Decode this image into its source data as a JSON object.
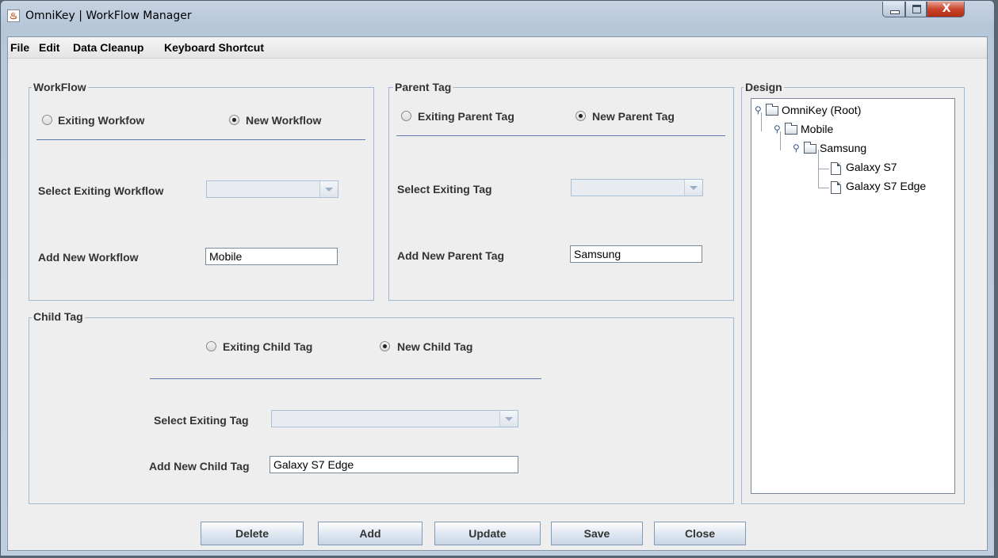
{
  "window": {
    "title": "OmniKey | WorkFlow Manager",
    "close_glyph": "X"
  },
  "menu": [
    "File",
    "Edit",
    "Data Cleanup",
    "Keyboard Shortcut"
  ],
  "workflow": {
    "title": "WorkFlow",
    "radio_existing": "Exiting Workfow",
    "radio_new": "New Workflow",
    "selected": "new",
    "select_label": "Select Exiting Workflow",
    "select_value": "",
    "add_label": "Add New Workflow",
    "add_value": "Mobile"
  },
  "parent_tag": {
    "title": "Parent Tag",
    "radio_existing": "Exiting Parent Tag",
    "radio_new": "New Parent Tag",
    "selected": "new",
    "select_label": "Select Exiting Tag",
    "select_value": "",
    "add_label": "Add New Parent Tag",
    "add_value": "Samsung"
  },
  "child_tag": {
    "title": "Child Tag",
    "radio_existing": "Exiting Child Tag",
    "radio_new": "New Child Tag",
    "selected": "new",
    "select_label": "Select Exiting Tag",
    "select_value": "",
    "add_label": "Add New Child Tag",
    "add_value": "Galaxy S7 Edge"
  },
  "design": {
    "title": "Design",
    "tree": [
      {
        "label": "OmniKey (Root)",
        "type": "folder",
        "depth": 0
      },
      {
        "label": "Mobile",
        "type": "folder",
        "depth": 1
      },
      {
        "label": "Samsung",
        "type": "folder",
        "depth": 2
      },
      {
        "label": "Galaxy S7",
        "type": "file",
        "depth": 3
      },
      {
        "label": "Galaxy S7 Edge",
        "type": "file",
        "depth": 3
      }
    ]
  },
  "buttons": {
    "delete": "Delete",
    "add": "Add",
    "update": "Update",
    "save": "Save",
    "close": "Close"
  },
  "icons": {
    "app": "java-app-icon",
    "folder": "folder-icon",
    "file": "file-icon",
    "tree_handle": "tree-handle-icon"
  }
}
